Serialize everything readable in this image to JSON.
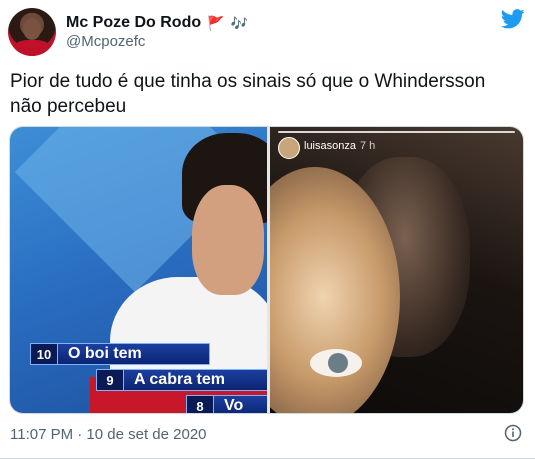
{
  "author": {
    "display_name": "Mc Poze Do Rodo",
    "emoji_flag": "🚩",
    "emoji_notes": "🎶",
    "handle": "@Mcpozefc"
  },
  "tweet": {
    "text": "Pior de tudo é que tinha os sinais só que o Whindersson não percebeu"
  },
  "media": {
    "left_panel": {
      "questions": [
        {
          "num": "10",
          "text": "O boi tem"
        },
        {
          "num": "9",
          "text": "A cabra tem"
        },
        {
          "num": "8",
          "text": "Vo"
        }
      ]
    },
    "right_panel": {
      "story_user": "luisasonza",
      "story_time": "7 h"
    }
  },
  "footer": {
    "timestamp": "11:07 PM · 10 de set de 2020"
  },
  "colors": {
    "brand": "#1d9bf0",
    "text_primary": "#0f1419",
    "text_secondary": "#536471"
  },
  "icons": {
    "brand": "twitter-bird-icon",
    "info": "info-icon"
  }
}
